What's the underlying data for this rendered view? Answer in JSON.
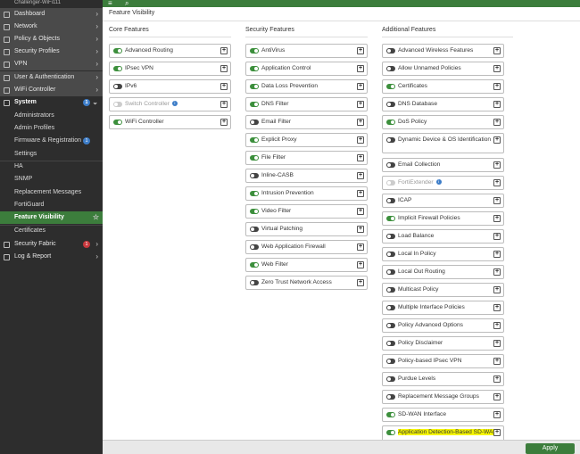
{
  "app": {
    "device_name": "Challenger-WiFi111"
  },
  "topbar": {
    "menu_icon": "hamburger-icon",
    "search_icon": "search-icon"
  },
  "sidebar": {
    "items": [
      {
        "label": "Dashboard",
        "chev": "›"
      },
      {
        "label": "Network",
        "chev": "›"
      },
      {
        "label": "Policy & Objects",
        "chev": "›"
      },
      {
        "label": "Security Profiles",
        "chev": "›"
      },
      {
        "label": "VPN",
        "chev": "›"
      },
      {
        "label": "User & Authentication",
        "chev": "›"
      },
      {
        "label": "WiFi Controller",
        "chev": "›"
      },
      {
        "label": "System",
        "badge": "1",
        "chev": "⌄"
      },
      {
        "label": "Administrators"
      },
      {
        "label": "Admin Profiles"
      },
      {
        "label": "Firmware & Registration",
        "badge": "1"
      },
      {
        "label": "Settings"
      },
      {
        "label": "HA"
      },
      {
        "label": "SNMP"
      },
      {
        "label": "Replacement Messages"
      },
      {
        "label": "FortiGuard"
      },
      {
        "label": "Feature Visibility"
      },
      {
        "label": "Certificates"
      },
      {
        "label": "Security Fabric",
        "badge": "1",
        "chev": "›"
      },
      {
        "label": "Log & Report",
        "chev": "›"
      }
    ],
    "star_icon": "☆"
  },
  "main": {
    "page_title": "Feature Visibility",
    "columns": [
      {
        "heading": "Core Features",
        "features": [
          {
            "label": "Advanced Routing",
            "state": "on"
          },
          {
            "label": "IPsec VPN",
            "state": "on"
          },
          {
            "label": "IPv6",
            "state": "off"
          },
          {
            "label": "Switch Controller",
            "state": "disabled",
            "info": "i"
          },
          {
            "label": "WiFi Controller",
            "state": "on"
          }
        ]
      },
      {
        "heading": "Security Features",
        "features": [
          {
            "label": "AntiVirus",
            "state": "on"
          },
          {
            "label": "Application Control",
            "state": "on"
          },
          {
            "label": "Data Loss Prevention",
            "state": "on"
          },
          {
            "label": "DNS Filter",
            "state": "on"
          },
          {
            "label": "Email Filter",
            "state": "off"
          },
          {
            "label": "Explicit Proxy",
            "state": "on"
          },
          {
            "label": "File Filter",
            "state": "on"
          },
          {
            "label": "Inline-CASB",
            "state": "off"
          },
          {
            "label": "Intrusion Prevention",
            "state": "on"
          },
          {
            "label": "Video Filter",
            "state": "on"
          },
          {
            "label": "Virtual Patching",
            "state": "off"
          },
          {
            "label": "Web Application Firewall",
            "state": "off"
          },
          {
            "label": "Web Filter",
            "state": "on"
          },
          {
            "label": "Zero Trust Network Access",
            "state": "off"
          }
        ]
      },
      {
        "heading": "Additional Features",
        "features": [
          {
            "label": "Advanced Wireless Features",
            "state": "off"
          },
          {
            "label": "Allow Unnamed Policies",
            "state": "off"
          },
          {
            "label": "Certificates",
            "state": "on"
          },
          {
            "label": "DNS Database",
            "state": "off"
          },
          {
            "label": "DoS Policy",
            "state": "on"
          },
          {
            "label": "Dynamic Device & OS Identification",
            "state": "off",
            "tall": true
          },
          {
            "label": "Email Collection",
            "state": "off"
          },
          {
            "label": "FortiExtender",
            "state": "disabled",
            "info": "i"
          },
          {
            "label": "ICAP",
            "state": "off"
          },
          {
            "label": "Implicit Firewall Policies",
            "state": "on"
          },
          {
            "label": "Load Balance",
            "state": "off"
          },
          {
            "label": "Local In Policy",
            "state": "off"
          },
          {
            "label": "Local Out Routing",
            "state": "off"
          },
          {
            "label": "Multicast Policy",
            "state": "off"
          },
          {
            "label": "Multiple Interface Policies",
            "state": "off"
          },
          {
            "label": "Policy Advanced Options",
            "state": "off"
          },
          {
            "label": "Policy Disclaimer",
            "state": "off"
          },
          {
            "label": "Policy-based IPsec VPN",
            "state": "off"
          },
          {
            "label": "Purdue Levels",
            "state": "off"
          },
          {
            "label": "Replacement Message Groups",
            "state": "off"
          },
          {
            "label": "SD-WAN Interface",
            "state": "on"
          },
          {
            "label": "Application Detection-Based SD-WAN",
            "state": "on",
            "tall": true,
            "highlight": true
          }
        ]
      }
    ],
    "plus_glyph": "+"
  },
  "footer": {
    "apply_label": "Apply"
  },
  "colors": {
    "accent": "#3c7d3c",
    "sidebar": "#2d2d2d",
    "highlight": "#f5f500"
  }
}
